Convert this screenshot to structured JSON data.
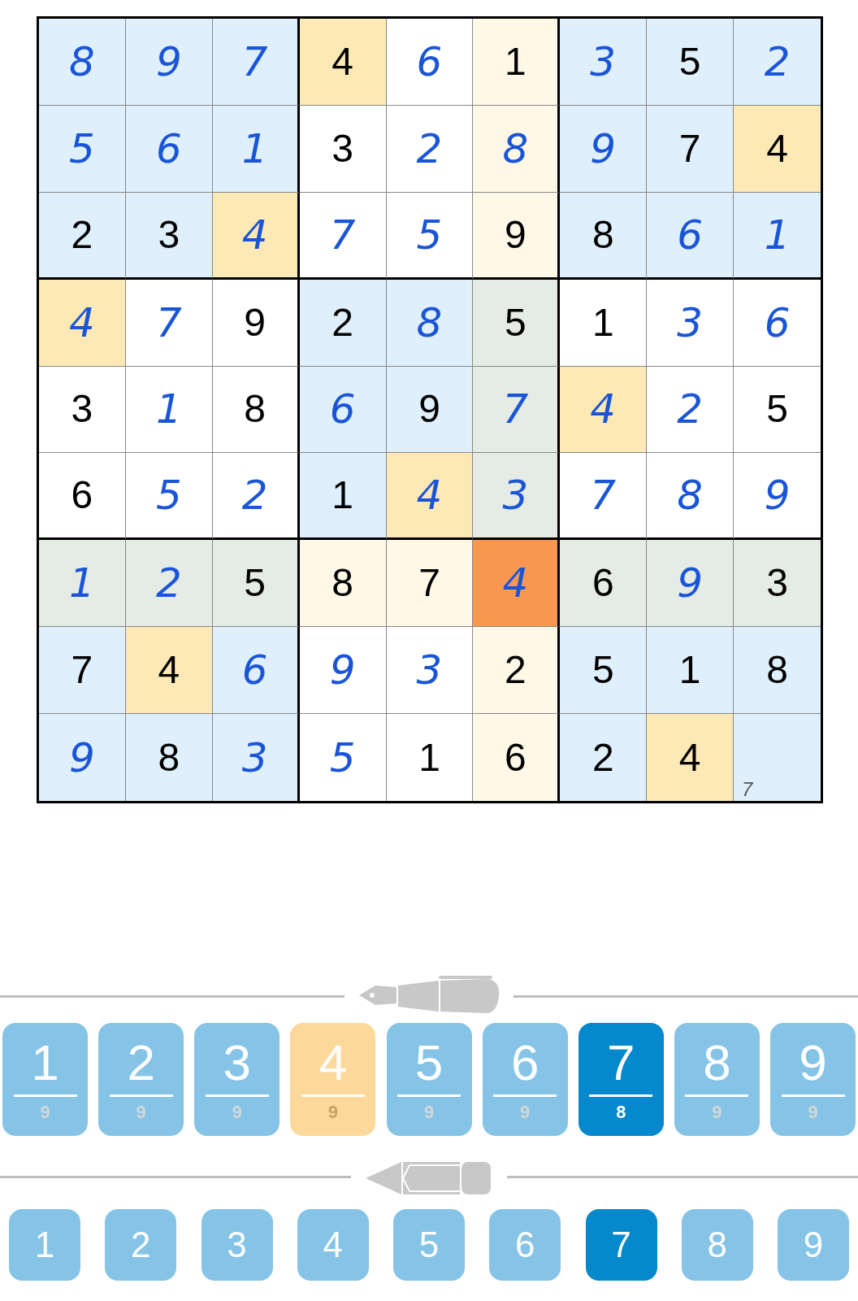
{
  "grid": [
    [
      {
        "value": "8",
        "kind": "entered",
        "selected": false,
        "same_digit": false,
        "in_line": false
      },
      {
        "value": "9",
        "kind": "entered",
        "selected": false,
        "same_digit": false,
        "in_line": false
      },
      {
        "value": "7",
        "kind": "entered",
        "selected": false,
        "same_digit": false,
        "in_line": false
      },
      {
        "value": "4",
        "kind": "given",
        "selected": false,
        "same_digit": true,
        "in_line": false
      },
      {
        "value": "6",
        "kind": "entered",
        "selected": false,
        "same_digit": false,
        "in_line": false
      },
      {
        "value": "1",
        "kind": "given",
        "selected": false,
        "same_digit": false,
        "in_line": true
      },
      {
        "value": "3",
        "kind": "entered",
        "selected": false,
        "same_digit": false,
        "in_line": false
      },
      {
        "value": "5",
        "kind": "given",
        "selected": false,
        "same_digit": false,
        "in_line": false
      },
      {
        "value": "2",
        "kind": "entered",
        "selected": false,
        "same_digit": false,
        "in_line": false
      }
    ],
    [
      {
        "value": "5",
        "kind": "entered",
        "selected": false,
        "same_digit": false,
        "in_line": false
      },
      {
        "value": "6",
        "kind": "entered",
        "selected": false,
        "same_digit": false,
        "in_line": false
      },
      {
        "value": "1",
        "kind": "entered",
        "selected": false,
        "same_digit": false,
        "in_line": false
      },
      {
        "value": "3",
        "kind": "given",
        "selected": false,
        "same_digit": false,
        "in_line": false
      },
      {
        "value": "2",
        "kind": "entered",
        "selected": false,
        "same_digit": false,
        "in_line": false
      },
      {
        "value": "8",
        "kind": "entered",
        "selected": false,
        "same_digit": false,
        "in_line": true
      },
      {
        "value": "9",
        "kind": "entered",
        "selected": false,
        "same_digit": false,
        "in_line": false
      },
      {
        "value": "7",
        "kind": "given",
        "selected": false,
        "same_digit": false,
        "in_line": false
      },
      {
        "value": "4",
        "kind": "given",
        "selected": false,
        "same_digit": true,
        "in_line": false
      }
    ],
    [
      {
        "value": "2",
        "kind": "given",
        "selected": false,
        "same_digit": false,
        "in_line": false
      },
      {
        "value": "3",
        "kind": "given",
        "selected": false,
        "same_digit": false,
        "in_line": false
      },
      {
        "value": "4",
        "kind": "entered",
        "selected": false,
        "same_digit": true,
        "in_line": false
      },
      {
        "value": "7",
        "kind": "entered",
        "selected": false,
        "same_digit": false,
        "in_line": false
      },
      {
        "value": "5",
        "kind": "entered",
        "selected": false,
        "same_digit": false,
        "in_line": false
      },
      {
        "value": "9",
        "kind": "given",
        "selected": false,
        "same_digit": false,
        "in_line": true
      },
      {
        "value": "8",
        "kind": "given",
        "selected": false,
        "same_digit": false,
        "in_line": false
      },
      {
        "value": "6",
        "kind": "entered",
        "selected": false,
        "same_digit": false,
        "in_line": false
      },
      {
        "value": "1",
        "kind": "entered",
        "selected": false,
        "same_digit": false,
        "in_line": false
      }
    ],
    [
      {
        "value": "4",
        "kind": "entered",
        "selected": false,
        "same_digit": true,
        "in_line": false
      },
      {
        "value": "7",
        "kind": "entered",
        "selected": false,
        "same_digit": false,
        "in_line": false
      },
      {
        "value": "9",
        "kind": "given",
        "selected": false,
        "same_digit": false,
        "in_line": false
      },
      {
        "value": "2",
        "kind": "given",
        "selected": false,
        "same_digit": false,
        "in_line": false
      },
      {
        "value": "8",
        "kind": "entered",
        "selected": false,
        "same_digit": false,
        "in_line": false
      },
      {
        "value": "5",
        "kind": "given",
        "selected": false,
        "same_digit": false,
        "in_line": true
      },
      {
        "value": "1",
        "kind": "given",
        "selected": false,
        "same_digit": false,
        "in_line": false
      },
      {
        "value": "3",
        "kind": "entered",
        "selected": false,
        "same_digit": false,
        "in_line": false
      },
      {
        "value": "6",
        "kind": "entered",
        "selected": false,
        "same_digit": false,
        "in_line": false
      }
    ],
    [
      {
        "value": "3",
        "kind": "given",
        "selected": false,
        "same_digit": false,
        "in_line": false
      },
      {
        "value": "1",
        "kind": "entered",
        "selected": false,
        "same_digit": false,
        "in_line": false
      },
      {
        "value": "8",
        "kind": "given",
        "selected": false,
        "same_digit": false,
        "in_line": false
      },
      {
        "value": "6",
        "kind": "entered",
        "selected": false,
        "same_digit": false,
        "in_line": false
      },
      {
        "value": "9",
        "kind": "given",
        "selected": false,
        "same_digit": false,
        "in_line": false
      },
      {
        "value": "7",
        "kind": "entered",
        "selected": false,
        "same_digit": false,
        "in_line": true
      },
      {
        "value": "4",
        "kind": "entered",
        "selected": false,
        "same_digit": true,
        "in_line": false
      },
      {
        "value": "2",
        "kind": "entered",
        "selected": false,
        "same_digit": false,
        "in_line": false
      },
      {
        "value": "5",
        "kind": "given",
        "selected": false,
        "same_digit": false,
        "in_line": false
      }
    ],
    [
      {
        "value": "6",
        "kind": "given",
        "selected": false,
        "same_digit": false,
        "in_line": false
      },
      {
        "value": "5",
        "kind": "entered",
        "selected": false,
        "same_digit": false,
        "in_line": false
      },
      {
        "value": "2",
        "kind": "entered",
        "selected": false,
        "same_digit": false,
        "in_line": false
      },
      {
        "value": "1",
        "kind": "given",
        "selected": false,
        "same_digit": false,
        "in_line": false
      },
      {
        "value": "4",
        "kind": "entered",
        "selected": false,
        "same_digit": true,
        "in_line": false
      },
      {
        "value": "3",
        "kind": "entered",
        "selected": false,
        "same_digit": false,
        "in_line": true
      },
      {
        "value": "7",
        "kind": "entered",
        "selected": false,
        "same_digit": false,
        "in_line": false
      },
      {
        "value": "8",
        "kind": "entered",
        "selected": false,
        "same_digit": false,
        "in_line": false
      },
      {
        "value": "9",
        "kind": "entered",
        "selected": false,
        "same_digit": false,
        "in_line": false
      }
    ],
    [
      {
        "value": "1",
        "kind": "entered",
        "selected": false,
        "same_digit": false,
        "in_line": true
      },
      {
        "value": "2",
        "kind": "entered",
        "selected": false,
        "same_digit": false,
        "in_line": true
      },
      {
        "value": "5",
        "kind": "given",
        "selected": false,
        "same_digit": false,
        "in_line": true
      },
      {
        "value": "8",
        "kind": "given",
        "selected": false,
        "same_digit": false,
        "in_line": true
      },
      {
        "value": "7",
        "kind": "given",
        "selected": false,
        "same_digit": false,
        "in_line": true
      },
      {
        "value": "4",
        "kind": "entered",
        "selected": true,
        "same_digit": false,
        "in_line": false
      },
      {
        "value": "6",
        "kind": "given",
        "selected": false,
        "same_digit": false,
        "in_line": true
      },
      {
        "value": "9",
        "kind": "entered",
        "selected": false,
        "same_digit": false,
        "in_line": true
      },
      {
        "value": "3",
        "kind": "given",
        "selected": false,
        "same_digit": false,
        "in_line": true
      }
    ],
    [
      {
        "value": "7",
        "kind": "given",
        "selected": false,
        "same_digit": false,
        "in_line": false
      },
      {
        "value": "4",
        "kind": "given",
        "selected": false,
        "same_digit": true,
        "in_line": false
      },
      {
        "value": "6",
        "kind": "entered",
        "selected": false,
        "same_digit": false,
        "in_line": false
      },
      {
        "value": "9",
        "kind": "entered",
        "selected": false,
        "same_digit": false,
        "in_line": false
      },
      {
        "value": "3",
        "kind": "entered",
        "selected": false,
        "same_digit": false,
        "in_line": false
      },
      {
        "value": "2",
        "kind": "given",
        "selected": false,
        "same_digit": false,
        "in_line": true
      },
      {
        "value": "5",
        "kind": "given",
        "selected": false,
        "same_digit": false,
        "in_line": false
      },
      {
        "value": "1",
        "kind": "given",
        "selected": false,
        "same_digit": false,
        "in_line": false
      },
      {
        "value": "8",
        "kind": "given",
        "selected": false,
        "same_digit": false,
        "in_line": false
      }
    ],
    [
      {
        "value": "9",
        "kind": "entered",
        "selected": false,
        "same_digit": false,
        "in_line": false
      },
      {
        "value": "8",
        "kind": "given",
        "selected": false,
        "same_digit": false,
        "in_line": false
      },
      {
        "value": "3",
        "kind": "entered",
        "selected": false,
        "same_digit": false,
        "in_line": false
      },
      {
        "value": "5",
        "kind": "entered",
        "selected": false,
        "same_digit": false,
        "in_line": false
      },
      {
        "value": "1",
        "kind": "given",
        "selected": false,
        "same_digit": false,
        "in_line": false
      },
      {
        "value": "6",
        "kind": "given",
        "selected": false,
        "same_digit": false,
        "in_line": true
      },
      {
        "value": "2",
        "kind": "given",
        "selected": false,
        "same_digit": false,
        "in_line": false
      },
      {
        "value": "4",
        "kind": "given",
        "selected": false,
        "same_digit": true,
        "in_line": false
      },
      {
        "kind": "empty",
        "selected": false,
        "same_digit": false,
        "in_line": false,
        "notes": [
          "7"
        ]
      }
    ]
  ],
  "pen_pad": [
    {
      "digit": "1",
      "remaining": "9",
      "selected": false,
      "matching": false
    },
    {
      "digit": "2",
      "remaining": "9",
      "selected": false,
      "matching": false
    },
    {
      "digit": "3",
      "remaining": "9",
      "selected": false,
      "matching": false
    },
    {
      "digit": "4",
      "remaining": "9",
      "selected": false,
      "matching": true
    },
    {
      "digit": "5",
      "remaining": "9",
      "selected": false,
      "matching": false
    },
    {
      "digit": "6",
      "remaining": "9",
      "selected": false,
      "matching": false
    },
    {
      "digit": "7",
      "remaining": "8",
      "selected": true,
      "matching": false
    },
    {
      "digit": "8",
      "remaining": "9",
      "selected": false,
      "matching": false
    },
    {
      "digit": "9",
      "remaining": "9",
      "selected": false,
      "matching": false
    }
  ],
  "pencil_pad": [
    {
      "digit": "1",
      "selected": false
    },
    {
      "digit": "2",
      "selected": false
    },
    {
      "digit": "3",
      "selected": false
    },
    {
      "digit": "4",
      "selected": false
    },
    {
      "digit": "5",
      "selected": false
    },
    {
      "digit": "6",
      "selected": false
    },
    {
      "digit": "7",
      "selected": true
    },
    {
      "digit": "8",
      "selected": false
    },
    {
      "digit": "9",
      "selected": false
    }
  ]
}
